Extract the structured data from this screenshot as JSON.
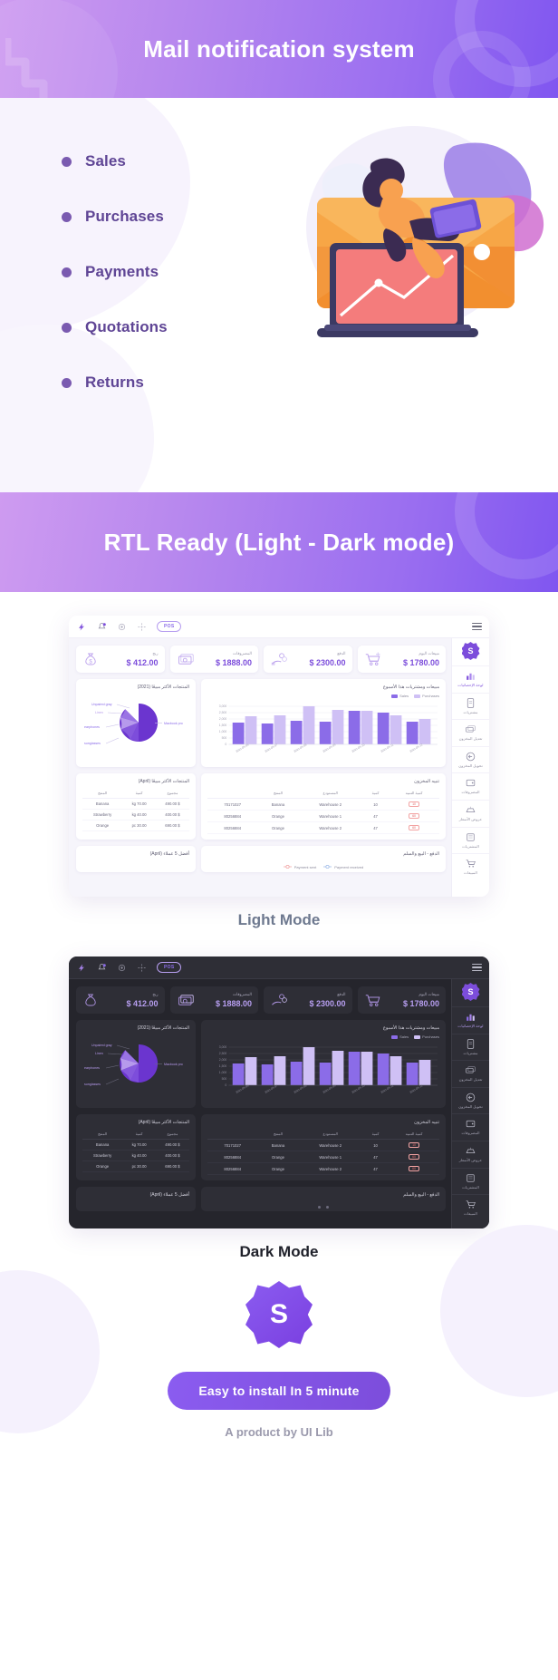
{
  "banner1": {
    "title": "Mail notification system"
  },
  "features": {
    "items": [
      {
        "label": "Sales"
      },
      {
        "label": "Purchases"
      },
      {
        "label": "Payments"
      },
      {
        "label": "Quotations"
      },
      {
        "label": "Returns"
      }
    ]
  },
  "banner2": {
    "title": "RTL Ready (Light - Dark mode)"
  },
  "captions": {
    "light": "Light Mode",
    "dark": "Dark Mode"
  },
  "dashboard": {
    "topbar": {
      "pos_label": "POS"
    },
    "kpis": [
      {
        "label": "ربح",
        "value": "$ 412.00",
        "icon": "money-bag-icon"
      },
      {
        "label": "المصروفات",
        "value": "$ 1888.00",
        "icon": "banknotes-icon"
      },
      {
        "label": "الدفع",
        "value": "$ 2300.00",
        "icon": "hand-coins-icon"
      },
      {
        "label": "مبيعات اليوم",
        "value": "$ 1780.00",
        "icon": "cart-plus-icon"
      }
    ],
    "pie_panel": {
      "title": "المنتجات الأكثر مبيعًا (2021)"
    },
    "bar_panel": {
      "title": "مبيعات ومشتريات هذا الأسبوع",
      "legend": [
        {
          "label": "Sales",
          "color": "#8b6ce8"
        },
        {
          "label": "Purchases",
          "color": "#cfc0f5"
        }
      ]
    },
    "top_products": {
      "title": "المنتجات الأكثر مبيعًا (April)",
      "headers": [
        "مجموع",
        "كمية",
        "المنتج"
      ],
      "rows": [
        [
          "$ 490.00",
          "kg 70.00",
          "Banana"
        ],
        [
          "$ 400.00",
          "kg 40.00",
          "Strawberry"
        ],
        [
          "$ 690.00",
          "pc 30.00",
          "Orange"
        ]
      ]
    },
    "stock_alert": {
      "title": "تنبيه المخزون",
      "headers": [
        "كمية التنبيه",
        "كمية",
        "المستودع",
        "المنتج"
      ],
      "rows": [
        [
          "10",
          "10",
          "Warehouse 2",
          "Banana",
          "70171027"
        ],
        [
          "60",
          "47",
          "Warehouse 1",
          "Orange",
          "80256884"
        ],
        [
          "60",
          "47",
          "Warehouse 2",
          "Orange",
          "80256884"
        ]
      ]
    },
    "payments_panel": {
      "title": "الدفع - البيع والسلم",
      "legend": [
        {
          "label": "Payment sent",
          "color": "#f0a0a0"
        },
        {
          "label": "Payment received",
          "color": "#9ab8e8"
        }
      ]
    },
    "sidebar": {
      "logo": "S",
      "items": [
        {
          "label": "لوحة الإحصائيات",
          "icon": "chart-bars-icon",
          "active": true
        },
        {
          "label": "مشتريات",
          "icon": "document-icon",
          "active": false
        },
        {
          "label": "تعديل المخزون",
          "icon": "cash-stack-icon",
          "active": false
        },
        {
          "label": "تحويل المخزون",
          "icon": "transfer-arrow-icon",
          "active": false
        },
        {
          "label": "المصروفات",
          "icon": "wallet-icon",
          "active": false
        },
        {
          "label": "عروض الأسعار",
          "icon": "price-tag-icon",
          "active": false
        },
        {
          "label": "المشتريات",
          "icon": "invoice-icon",
          "active": false
        },
        {
          "label": "المبيعات",
          "icon": "shopping-cart-icon",
          "active": false
        }
      ]
    }
  },
  "chart_data": [
    {
      "type": "pie",
      "title": "المنتجات الأكثر مبيعًا (2021)",
      "labels": [
        "Macbook pro",
        "sunglasses",
        "earphones",
        "Linen",
        "Unpaired gray"
      ],
      "values": [
        55,
        17,
        12,
        9,
        7
      ],
      "colors": [
        "#6b35cf",
        "#7d4ddb",
        "#9a74e4",
        "#b69aec",
        "#cfc0f5"
      ],
      "legend": "callout-labels"
    },
    {
      "type": "bar",
      "title": "مبيعات ومشتريات هذا الأسبوع",
      "categories": [
        "2021-05-06",
        "2021-05-07",
        "2021-05-08",
        "2021-05-09",
        "2021-05-10",
        "2021-05-11",
        "2021-05-12"
      ],
      "series": [
        {
          "name": "Sales",
          "color": "#8b6ce8",
          "values": [
            1720,
            1640,
            1860,
            1780,
            2650,
            2520,
            1760
          ]
        },
        {
          "name": "Purchases",
          "color": "#cfc0f5",
          "values": [
            2240,
            2310,
            3000,
            2720,
            2650,
            2290,
            1980
          ]
        }
      ],
      "ylabel": "",
      "xlabel": "",
      "ylim": [
        0,
        3000
      ],
      "yticks": [
        "0",
        "500",
        "1,000",
        "1,500",
        "2,000",
        "2,500",
        "3,000"
      ],
      "grid": true,
      "legend_position": "top-right"
    }
  ],
  "footer": {
    "logo": "S",
    "cta": "Easy to install In 5 minute",
    "byline": "A product by UI Lib"
  }
}
